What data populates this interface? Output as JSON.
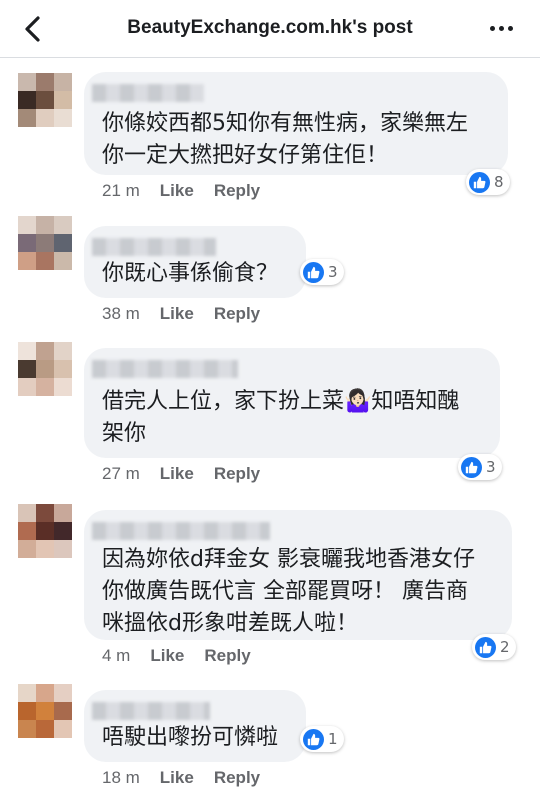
{
  "header": {
    "title": "BeautyExchange.com.hk's post"
  },
  "comments": [
    {
      "lines": [
        "你條姣西都5知你有無性病，家樂無左",
        "你一定大撚把好女仔第住佢！"
      ],
      "time": "21 m",
      "like": "Like",
      "reply": "Reply",
      "reactions": "8",
      "avatar": [
        "#c9b8ad",
        "#9b7b6c",
        "#c7b3a5",
        "#3a2a24",
        "#6b4e3e",
        "#d3bca6",
        "#a38a78",
        "#e0cdbf",
        "#e9ddd3"
      ]
    },
    {
      "lines": [
        "你既心事係偷食？"
      ],
      "time": "38 m",
      "like": "Like",
      "reply": "Reply",
      "reactions": "3",
      "avatar": [
        "#e3d6cd",
        "#c6b2a6",
        "#d9cbc1",
        "#7a6a77",
        "#8c7b78",
        "#5f6470",
        "#cf9f86",
        "#a97561",
        "#cbb9aa"
      ]
    },
    {
      "lines": [
        "借完人上位，家下扮上菜🤷🏻‍♀️知唔知醜",
        "架你"
      ],
      "time": "27 m",
      "like": "Like",
      "reply": "Reply",
      "reactions": "3",
      "avatar": [
        "#eee3db",
        "#c0a290",
        "#e2d3c8",
        "#4a3a30",
        "#b99b84",
        "#d8c1ae",
        "#e3cdc0",
        "#d5b2a0",
        "#ecdcd2"
      ]
    },
    {
      "lines": [
        "因為妳依d拜金女 影衰曬我地香港女仔",
        "你做廣告既代言 全部罷買呀！ 廣告商",
        "咪搵依d形象咁差既人啦！"
      ],
      "time": "4 m",
      "like": "Like",
      "reply": "Reply",
      "reactions": "2",
      "avatar": [
        "#d9c4b7",
        "#7c4a3c",
        "#c8a89a",
        "#b06b50",
        "#5a2e26",
        "#42282a",
        "#d2ad98",
        "#e2c5b4",
        "#dcc7bd"
      ]
    },
    {
      "lines": [
        "唔駛出嚟扮可憐啦"
      ],
      "time": "18 m",
      "like": "Like",
      "reply": "Reply",
      "reactions": "1",
      "avatar": [
        "#e6d6c8",
        "#d7a68b",
        "#e5cfc3",
        "#b9652d",
        "#d1813c",
        "#a86a4d",
        "#c9854f",
        "#b96839",
        "#e3c6b4"
      ]
    }
  ]
}
